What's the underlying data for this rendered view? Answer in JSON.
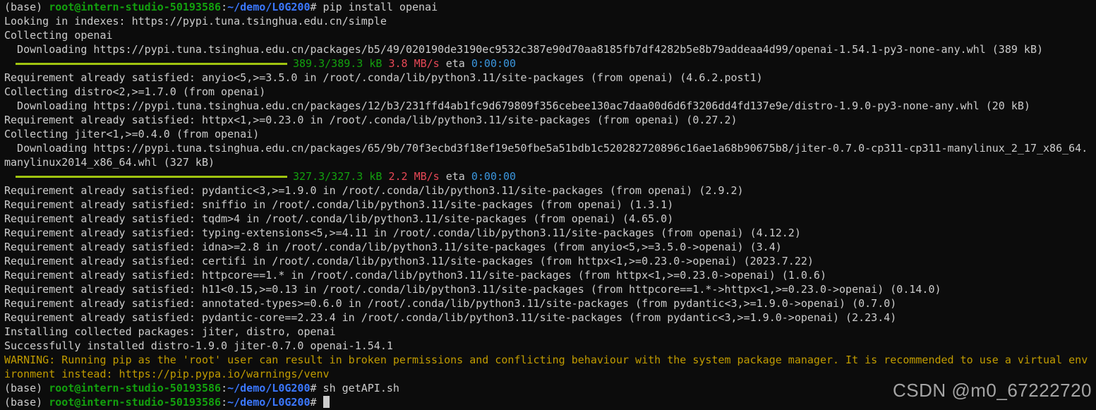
{
  "terminal": {
    "lines": [
      {
        "base": "(base) ",
        "user": "root@intern-studio-50193586",
        "sep": ":",
        "path": "~/demo/L0G200",
        "cmd": "# pip install openai"
      },
      "Looking in indexes: https://pypi.tuna.tsinghua.edu.cn/simple",
      "Collecting openai",
      "  Downloading https://pypi.tuna.tsinghua.edu.cn/packages/b5/49/020190de3190ec9532c387e90d70aa8185fb7df4282b5e8b79addeaa4d99/openai-1.54.1-py3-none-any.whl (389 kB)",
      {
        "progress": {
          "size": "389.3/389.3 kB",
          "speed": "3.8 MB/s",
          "eta_label": "eta",
          "eta": "0:00:00"
        }
      },
      "Requirement already satisfied: anyio<5,>=3.5.0 in /root/.conda/lib/python3.11/site-packages (from openai) (4.6.2.post1)",
      "Collecting distro<2,>=1.7.0 (from openai)",
      "  Downloading https://pypi.tuna.tsinghua.edu.cn/packages/12/b3/231ffd4ab1fc9d679809f356cebee130ac7daa00d6d6f3206dd4fd137e9e/distro-1.9.0-py3-none-any.whl (20 kB)",
      "Requirement already satisfied: httpx<1,>=0.23.0 in /root/.conda/lib/python3.11/site-packages (from openai) (0.27.2)",
      "Collecting jiter<1,>=0.4.0 (from openai)",
      "  Downloading https://pypi.tuna.tsinghua.edu.cn/packages/65/9b/70f3ecbd3f18ef19e50fbe5a51bdb1c520282720896c16ae1a68b90675b8/jiter-0.7.0-cp311-cp311-manylinux_2_17_x86_64.",
      "manylinux2014_x86_64.whl (327 kB)",
      {
        "progress": {
          "size": "327.3/327.3 kB",
          "speed": "2.2 MB/s",
          "eta_label": "eta",
          "eta": "0:00:00"
        }
      },
      "Requirement already satisfied: pydantic<3,>=1.9.0 in /root/.conda/lib/python3.11/site-packages (from openai) (2.9.2)",
      "Requirement already satisfied: sniffio in /root/.conda/lib/python3.11/site-packages (from openai) (1.3.1)",
      "Requirement already satisfied: tqdm>4 in /root/.conda/lib/python3.11/site-packages (from openai) (4.65.0)",
      "Requirement already satisfied: typing-extensions<5,>=4.11 in /root/.conda/lib/python3.11/site-packages (from openai) (4.12.2)",
      "Requirement already satisfied: idna>=2.8 in /root/.conda/lib/python3.11/site-packages (from anyio<5,>=3.5.0->openai) (3.4)",
      "Requirement already satisfied: certifi in /root/.conda/lib/python3.11/site-packages (from httpx<1,>=0.23.0->openai) (2023.7.22)",
      "Requirement already satisfied: httpcore==1.* in /root/.conda/lib/python3.11/site-packages (from httpx<1,>=0.23.0->openai) (1.0.6)",
      "Requirement already satisfied: h11<0.15,>=0.13 in /root/.conda/lib/python3.11/site-packages (from httpcore==1.*->httpx<1,>=0.23.0->openai) (0.14.0)",
      "Requirement already satisfied: annotated-types>=0.6.0 in /root/.conda/lib/python3.11/site-packages (from pydantic<3,>=1.9.0->openai) (0.7.0)",
      "Requirement already satisfied: pydantic-core==2.23.4 in /root/.conda/lib/python3.11/site-packages (from pydantic<3,>=1.9.0->openai) (2.23.4)",
      "Installing collected packages: jiter, distro, openai",
      "Successfully installed distro-1.9.0 jiter-0.7.0 openai-1.54.1",
      {
        "warn": "WARNING: Running pip as the 'root' user can result in broken permissions and conflicting behaviour with the system package manager. It is recommended to use a virtual env"
      },
      {
        "warn": "ironment instead: https://pip.pypa.io/warnings/venv"
      },
      {
        "base": "(base) ",
        "user": "root@intern-studio-50193586",
        "sep": ":",
        "path": "~/demo/L0G200",
        "cmd": "# sh getAPI.sh"
      },
      {
        "base": "(base) ",
        "user": "root@intern-studio-50193586",
        "sep": ":",
        "path": "~/demo/L0G200",
        "cmd": "# ",
        "cursor": true
      }
    ]
  },
  "watermark": "CSDN @m0_67222720",
  "colors": {
    "background": "#0c0c0c",
    "text": "#cccccc",
    "prompt_user": "#13a10e",
    "prompt_path": "#3b78ff",
    "warning": "#c19c00",
    "progress_bar": "#a0c410",
    "speed": "#e74856",
    "eta": "#3a96dd"
  }
}
